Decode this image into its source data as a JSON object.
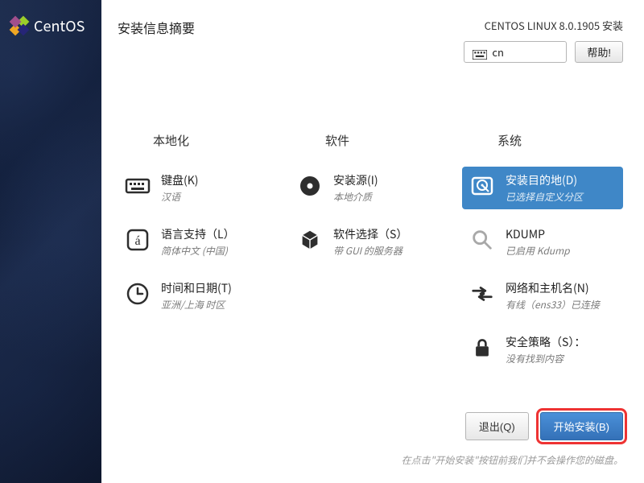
{
  "brand": "CentOS",
  "header": {
    "title": "安装信息摘要",
    "version": "CENTOS LINUX 8.0.1905 安装",
    "keyboard_indicator": "cn",
    "help": "帮助!"
  },
  "columns": {
    "local": {
      "heading": "本地化",
      "keyboard": {
        "title": "键盘(K)",
        "sub": "汉语"
      },
      "language": {
        "title": "语言支持（L）",
        "sub": "简体中文 (中国)"
      },
      "datetime": {
        "title": "时间和日期(T)",
        "sub": "亚洲/上海 时区"
      }
    },
    "software": {
      "heading": "软件",
      "source": {
        "title": "安装源(I)",
        "sub": "本地介质"
      },
      "selection": {
        "title": "软件选择（S）",
        "sub": "带 GUI 的服务器"
      }
    },
    "system": {
      "heading": "系统",
      "dest": {
        "title": "安装目的地(D)",
        "sub": "已选择自定义分区"
      },
      "kdump": {
        "title": "KDUMP",
        "sub": "已启用 Kdump"
      },
      "network": {
        "title": "网络和主机名(N)",
        "sub": "有线（ens33）已连接"
      },
      "security": {
        "title": "安全策略（S）：",
        "sub": "没有找到内容"
      }
    }
  },
  "footer": {
    "quit": "退出(Q)",
    "begin": "开始安装(B)",
    "hint": "在点击\"开始安装\"按钮前我们并不会操作您的磁盘。"
  }
}
